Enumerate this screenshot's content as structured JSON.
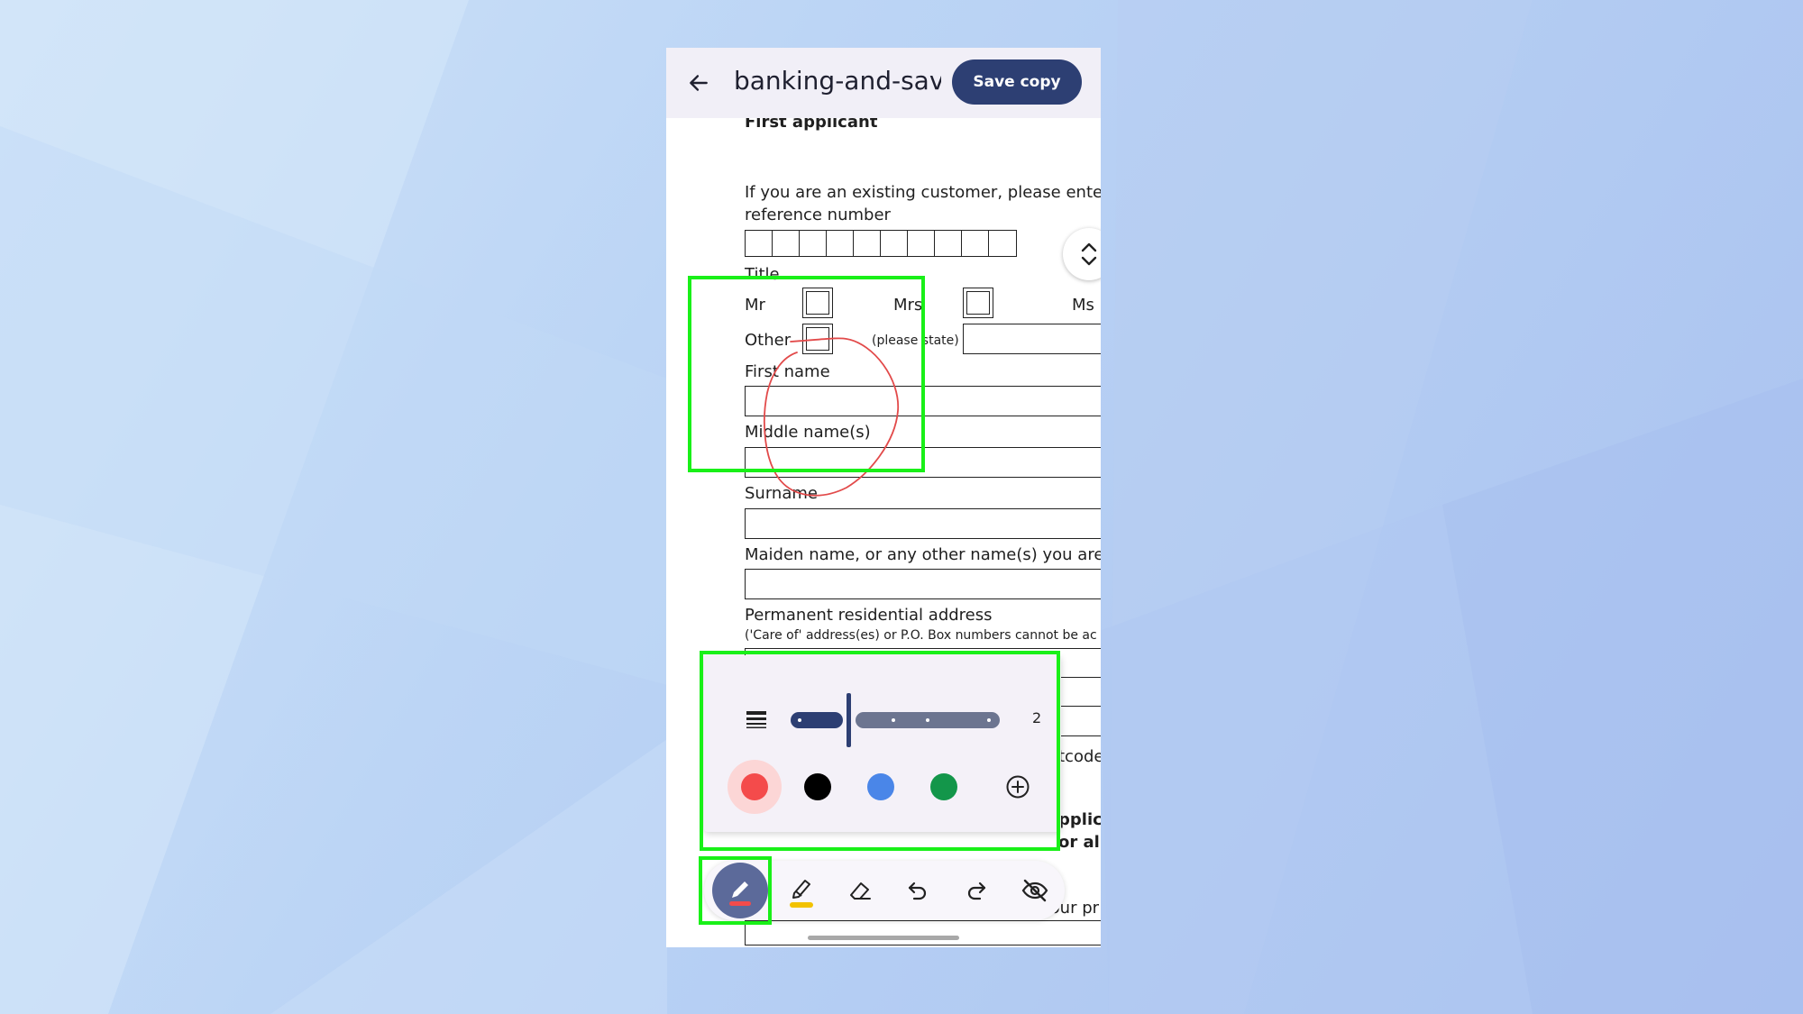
{
  "app": {
    "title": "banking-and-sav...",
    "save_label": "Save copy"
  },
  "form": {
    "heading": "First applicant",
    "ref_line1": "If you are an existing customer, please enter y",
    "ref_line2": "reference number",
    "title_label": "Title",
    "mr": "Mr",
    "mrs": "Mrs",
    "ms": "Ms",
    "other": "Other",
    "please_state": "(please state)",
    "first_name": "First name",
    "middle_names": "Middle name(s)",
    "surname": "Surname",
    "maiden_name": "Maiden name, or any other name(s) you are, o",
    "address_label": "Permanent residential address",
    "address_note": "('Care of' address(es) or P.O. Box numbers cannot be ac",
    "postcode_partial": "tcode",
    "section_partial_1": "pplica",
    "section_partial_2": "or all",
    "partial_bottom": "your pr"
  },
  "pen_panel": {
    "thickness_value": "2",
    "thickness_level": 2,
    "thickness_max": 5,
    "colors": [
      "#f44b4b",
      "#000000",
      "#4a86e8",
      "#13964a"
    ],
    "selected_color": "#f44b4b"
  },
  "toolbar": {
    "tools": [
      "pen-icon",
      "highlighter-icon",
      "eraser-icon",
      "undo-icon",
      "redo-icon",
      "hide-annotations-icon"
    ],
    "pen_color": "#f44b4b",
    "highlighter_color": "#f2c200"
  },
  "highlight_color": "#19f018"
}
